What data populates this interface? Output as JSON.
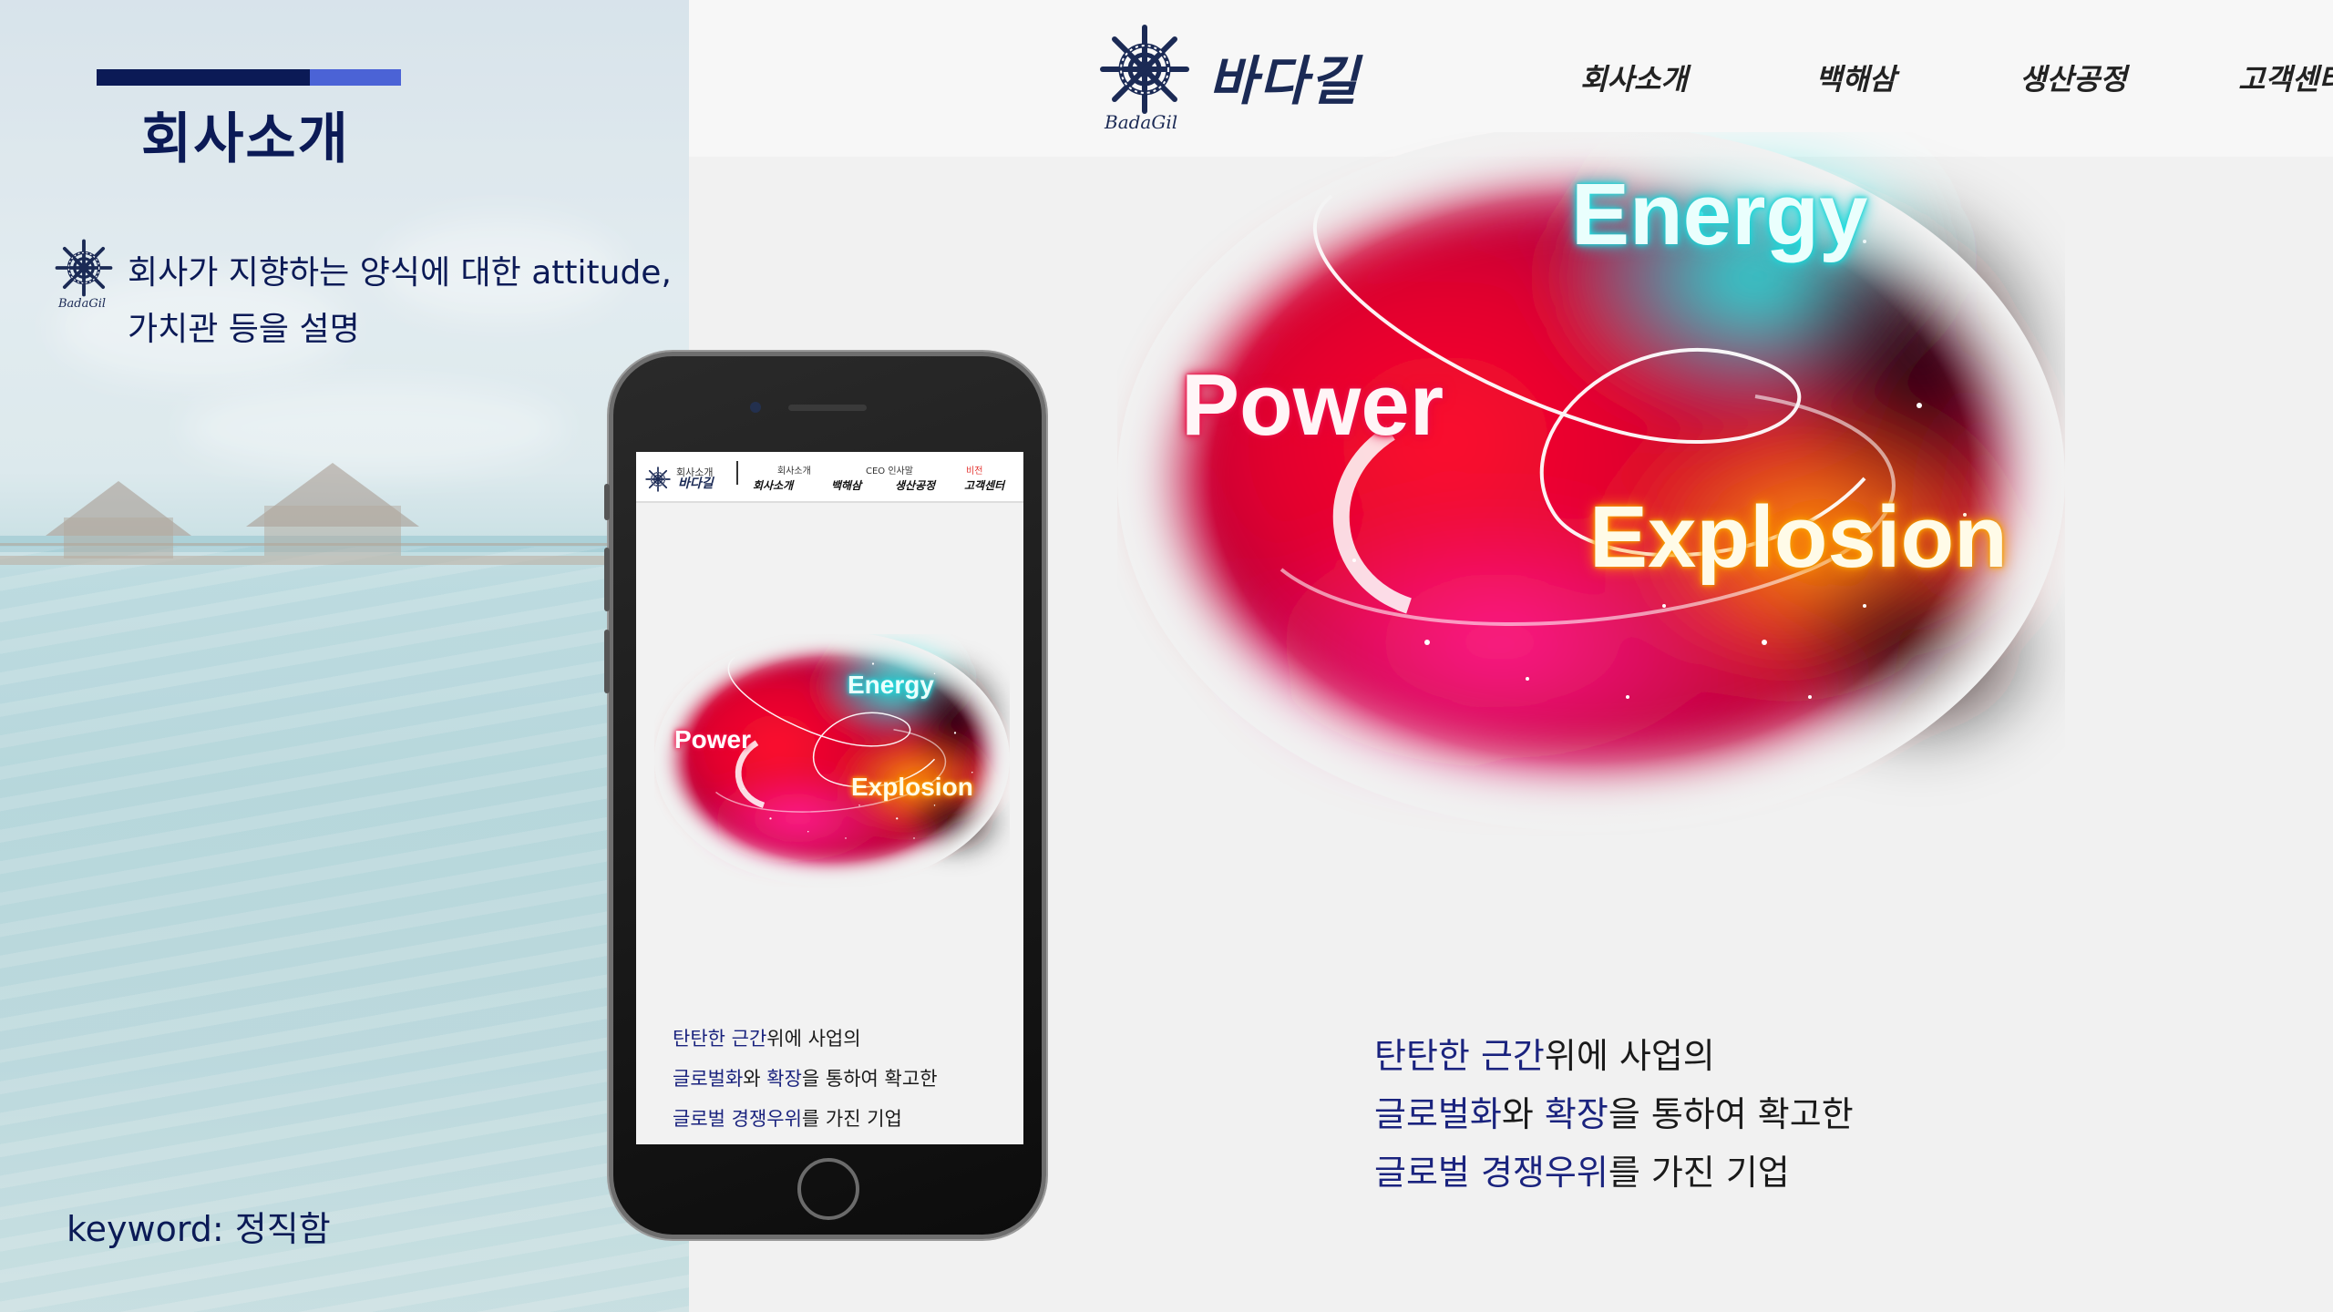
{
  "left_panel": {
    "title": "회사소개",
    "description_line1": "회사가 지향하는 양식에 대한 attitude,",
    "description_line2": "가치관 등을 설명",
    "keyword": "keyword: 정직함",
    "accent_colors": {
      "dark": "#0b1a56",
      "light": "#4b63d6"
    },
    "logo_icon": "ship-wheel-icon",
    "logo_caption": "BadaGil"
  },
  "site": {
    "logo": {
      "name": "바다길",
      "sub": "BadaGil",
      "icon": "ship-wheel-icon"
    },
    "nav": [
      "회사소개",
      "백해삼",
      "생산공정",
      "고객센터"
    ],
    "hero": {
      "energy": "Energy",
      "power": "Power",
      "explosion": "Explosion"
    },
    "body": {
      "line1_hl": "탄탄한 근간",
      "line1_rest": "위에 사업의",
      "line2_hl1": "글로벌화",
      "line2_mid": "와 ",
      "line2_hl2": "확장",
      "line2_rest": "을 통하여 확고한",
      "line3_hl": "글로벌 경쟁우위",
      "line3_rest": "를 가진 기업"
    },
    "highlight_color": "#1a237e"
  },
  "phone": {
    "header": {
      "logo_top": "회사소개",
      "logo_name": "바다길",
      "logo_caption": "BadaGil",
      "subs": [
        "회사소개",
        "CEO 인사말",
        "비전"
      ],
      "nav": [
        "회사소개",
        "백해삼",
        "생산공정",
        "고객센터"
      ],
      "vision_color": "#e53935"
    },
    "hero": {
      "energy": "Energy",
      "power": "Power",
      "explosion": "Explosion"
    },
    "body": {
      "line1_hl": "탄탄한 근간",
      "line1_rest": "위에 사업의",
      "line2_hl1": "글로벌화",
      "line2_mid": "와 ",
      "line2_hl2": "확장",
      "line2_rest": "을 통하여 확고한",
      "line3_hl": "글로벌 경쟁우위",
      "line3_rest": "를 가진 기업"
    }
  }
}
